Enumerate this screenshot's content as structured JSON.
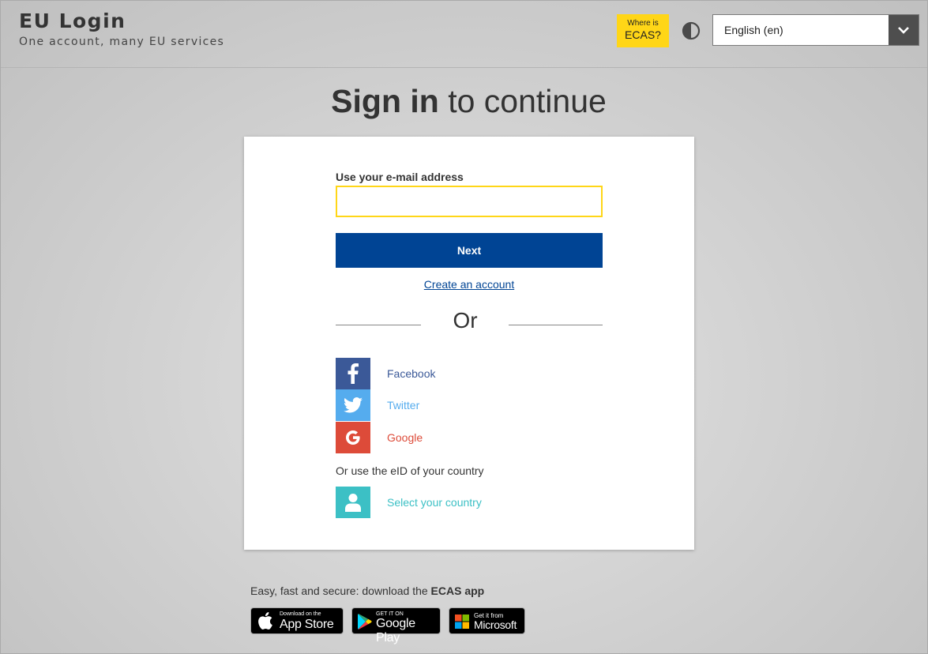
{
  "header": {
    "brand_title": "EU Login",
    "brand_subtitle": "One account, many EU services",
    "ecas_line1": "Where is",
    "ecas_line2": "ECAS?",
    "contrast_icon": "contrast-icon",
    "language_value": "English (en)"
  },
  "main": {
    "title_bold": "Sign in",
    "title_rest": " to continue"
  },
  "form": {
    "email_label": "Use your e-mail address",
    "email_value": "",
    "next_label": "Next",
    "create_account": "Create an account",
    "or_label": "Or"
  },
  "social": [
    {
      "label": "Facebook",
      "icon": "facebook-icon",
      "color": "#3b5998"
    },
    {
      "label": "Twitter",
      "icon": "twitter-icon",
      "color": "#55acee"
    },
    {
      "label": "Google",
      "icon": "google-icon",
      "color": "#dd4b39"
    }
  ],
  "eid": {
    "text": "Or use the eID of your country",
    "select_country": "Select your country",
    "icon": "person-icon",
    "color": "#3cc0c5"
  },
  "footer": {
    "text_prefix": "Easy, fast and secure: download the ",
    "text_bold": "ECAS app",
    "app_store_small": "Download on the",
    "app_store_big": "App Store",
    "google_play_small": "GET IT ON",
    "google_play_big": "Google Play",
    "microsoft_small": "Get it from",
    "microsoft_big": "Microsoft"
  },
  "colors": {
    "accent_yellow": "#ffd617",
    "primary_blue": "#004494"
  }
}
